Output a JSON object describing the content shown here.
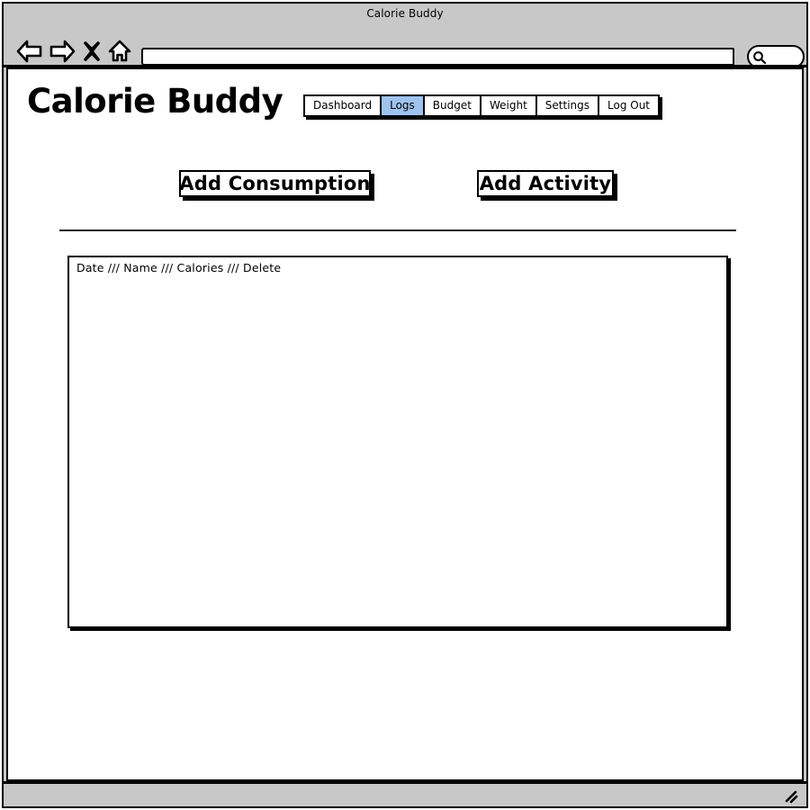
{
  "window": {
    "title": "Calorie Buddy"
  },
  "browser_chrome": {
    "icons": [
      {
        "name": "back-icon",
        "label": "Back"
      },
      {
        "name": "forward-icon",
        "label": "Forward"
      },
      {
        "name": "stop-icon",
        "label": "Stop"
      },
      {
        "name": "home-icon",
        "label": "Home"
      }
    ],
    "url_bar": {
      "value": "",
      "placeholder": ""
    },
    "search_box": {
      "value": "",
      "placeholder": "",
      "icon": "search-icon"
    }
  },
  "app": {
    "title": "Calorie Buddy",
    "nav_tabs": [
      {
        "label": "Dashboard",
        "active": false
      },
      {
        "label": "Logs",
        "active": true
      },
      {
        "label": "Budget",
        "active": false
      },
      {
        "label": "Weight",
        "active": false
      },
      {
        "label": "Settings",
        "active": false
      },
      {
        "label": "Log Out",
        "active": false
      }
    ],
    "actions": {
      "add_consumption_label": "Add Consumption",
      "add_activity_label": "Add Activity"
    },
    "log_table": {
      "header": "Date /// Name /// Calories /// Delete",
      "rows": []
    }
  },
  "status_bar": {
    "resize_grip": "resize-grip-icon"
  },
  "colors": {
    "chrome_gray": "#c8c8c8",
    "active_tab_blue": "#9ec3ee",
    "outline_black": "#000000",
    "page_white": "#ffffff"
  }
}
